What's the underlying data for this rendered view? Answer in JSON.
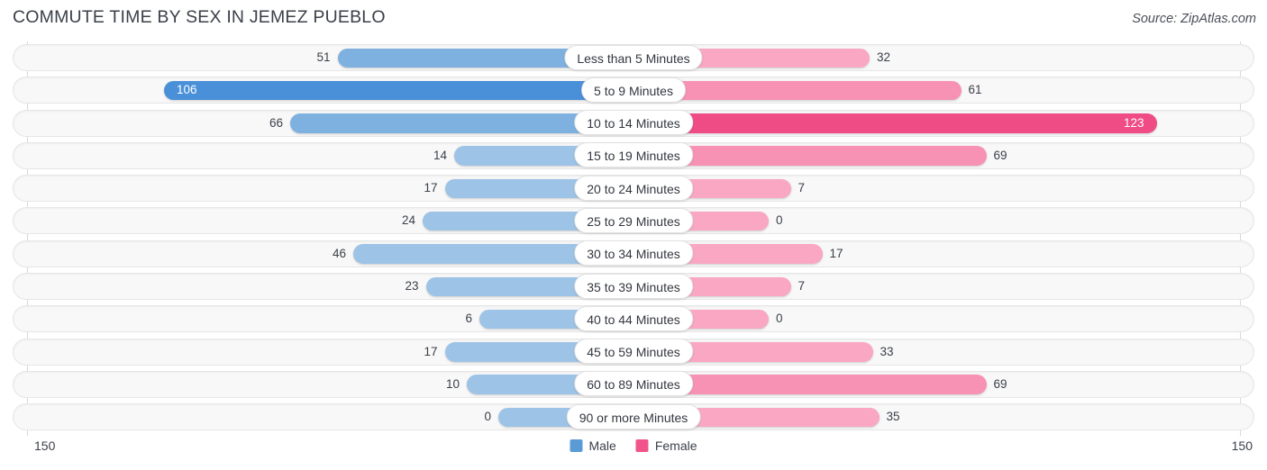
{
  "header": {
    "title": "COMMUTE TIME BY SEX IN JEMEZ PUEBLO",
    "source": "Source: ZipAtlas.com"
  },
  "legend": {
    "items": [
      {
        "label": "Male",
        "color": "#5b9bd5"
      },
      {
        "label": "Female",
        "color": "#f0548a"
      }
    ]
  },
  "axis": {
    "min_label": "150",
    "max_label": "150",
    "max_value": 150
  },
  "colors": {
    "male_light": "#9dc3e6",
    "male_mid": "#7fb1e0",
    "male_dark": "#4a90d9",
    "female_light": "#f9a7c3",
    "female_mid": "#f792b4",
    "female_dark": "#ef4c85",
    "track_bg": "#f8f8f8",
    "track_border": "#e6e6e6",
    "gridline": "#d8d8d8",
    "text": "#3b4049"
  },
  "chart_data": {
    "type": "bar",
    "title": "COMMUTE TIME BY SEX IN JEMEZ PUEBLO",
    "subtitle": "Source: ZipAtlas.com",
    "orientation": "horizontal-diverging",
    "xlabel": "",
    "ylabel": "",
    "xlim": [
      -150,
      150
    ],
    "grid": true,
    "legend_position": "bottom-center",
    "categories": [
      "Less than 5 Minutes",
      "5 to 9 Minutes",
      "10 to 14 Minutes",
      "15 to 19 Minutes",
      "20 to 24 Minutes",
      "25 to 29 Minutes",
      "30 to 34 Minutes",
      "35 to 39 Minutes",
      "40 to 44 Minutes",
      "45 to 59 Minutes",
      "60 to 89 Minutes",
      "90 or more Minutes"
    ],
    "series": [
      {
        "name": "Male",
        "side": "left",
        "color": "#5b9bd5",
        "values": [
          51,
          106,
          66,
          14,
          17,
          24,
          46,
          23,
          6,
          17,
          10,
          0
        ]
      },
      {
        "name": "Female",
        "side": "right",
        "color": "#f0548a",
        "values": [
          32,
          61,
          123,
          69,
          7,
          0,
          17,
          7,
          0,
          33,
          69,
          35
        ]
      }
    ]
  }
}
